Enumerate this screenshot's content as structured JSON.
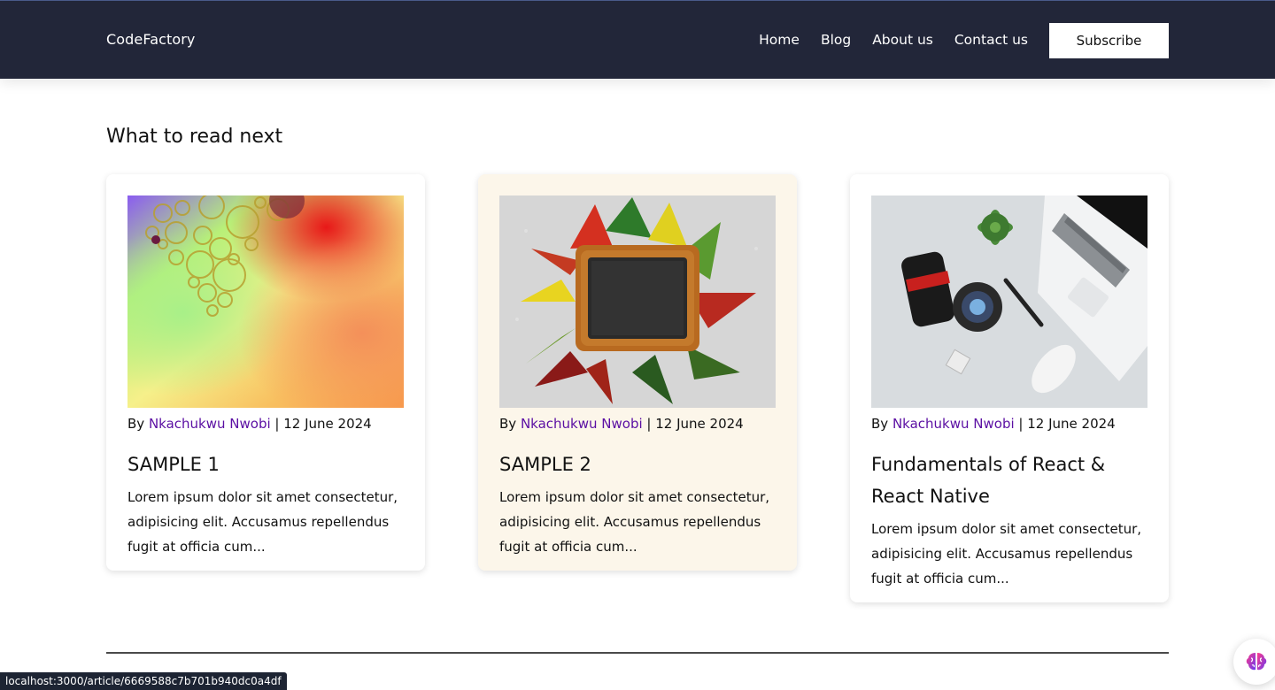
{
  "nav": {
    "brand": "CodeFactory",
    "links": [
      "Home",
      "Blog",
      "About us",
      "Contact us"
    ],
    "subscribe_label": "Subscribe"
  },
  "section": {
    "title": "What to read next"
  },
  "cards": [
    {
      "by": "By",
      "author": "Nkachukwu Nwobi",
      "separator": "|",
      "date": "12 June 2024",
      "title": "SAMPLE 1",
      "excerpt": "Lorem ipsum dolor sit amet consectetur, adipisicing elit. Accusamus repellendus fugit at officia cum...",
      "image": "colorful-oil-bubbles-photo"
    },
    {
      "by": "By",
      "author": "Nkachukwu Nwobi",
      "separator": "|",
      "date": "12 June 2024",
      "title": "SAMPLE 2",
      "excerpt": "Lorem ipsum dolor sit amet consectetur, adipisicing elit. Accusamus repellendus fugit at officia cum...",
      "image": "autumn-leaves-chalkboard-photo"
    },
    {
      "by": "By",
      "author": "Nkachukwu Nwobi",
      "separator": "|",
      "date": "12 June 2024",
      "title": "Fundamentals of React & React Native",
      "excerpt": "Lorem ipsum dolor sit amet consectetur, adipisicing elit. Accusamus repellendus fugit at officia cum...",
      "image": "laptop-camera-desk-photo"
    }
  ],
  "status_bar": {
    "url": "localhost:3000/article/6669588c7b701b940dc0a4df"
  },
  "colors": {
    "navbar": "#222639",
    "author": "#5b0fa3",
    "highlight_card": "#fcf6ea"
  },
  "icons": {
    "assistant": "brain-icon"
  }
}
